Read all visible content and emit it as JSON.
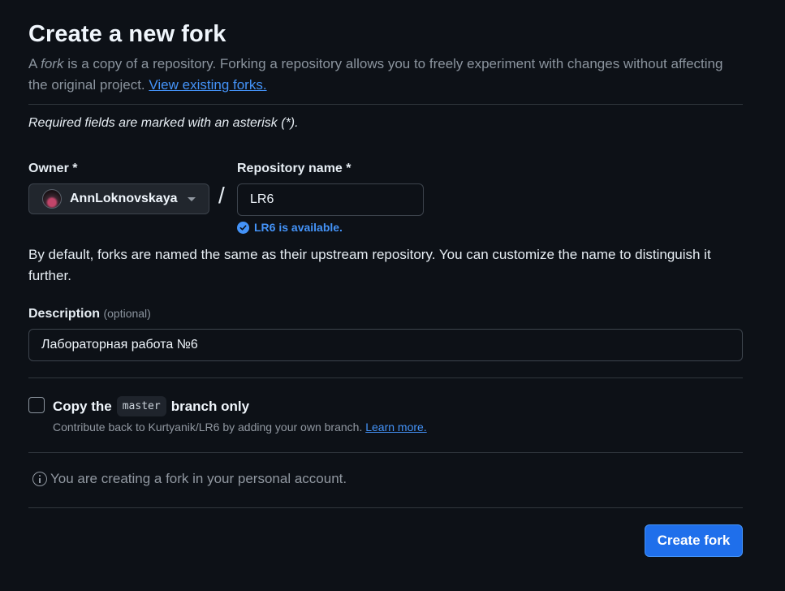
{
  "header": {
    "title": "Create a new fork",
    "subtitle_prefix": "A ",
    "subtitle_em": "fork",
    "subtitle_rest": " is a copy of a repository. Forking a repository allows you to freely experiment with changes without affecting the original project. ",
    "view_forks_link": "View existing forks."
  },
  "required_note": "Required fields are marked with an asterisk (*).",
  "owner": {
    "label": "Owner *",
    "value": "AnnLoknovskaya"
  },
  "separator": "/",
  "repository": {
    "label": "Repository name *",
    "value": "LR6",
    "availability": "LR6 is available."
  },
  "naming_help": "By default, forks are named the same as their upstream repository. You can customize the name to distinguish it further.",
  "description": {
    "label": "Description",
    "optional_label": "(optional)",
    "value": "Лабораторная работа №6"
  },
  "copy_branch": {
    "prefix": "Copy the",
    "branch": "master",
    "suffix": "branch only",
    "checked": false,
    "help_text": "Contribute back to Kurtyanik/LR6 by adding your own branch. ",
    "learn_more": "Learn more."
  },
  "info_message": "You are creating a fork in your personal account.",
  "actions": {
    "create_fork": "Create fork"
  },
  "colors": {
    "background": "#0d1117",
    "accent": "#4493f8",
    "primary_button": "#1f6feb",
    "border": "#30363d"
  },
  "icons": [
    "avatar",
    "chevron-down-icon",
    "check-circle-icon",
    "info-icon"
  ]
}
